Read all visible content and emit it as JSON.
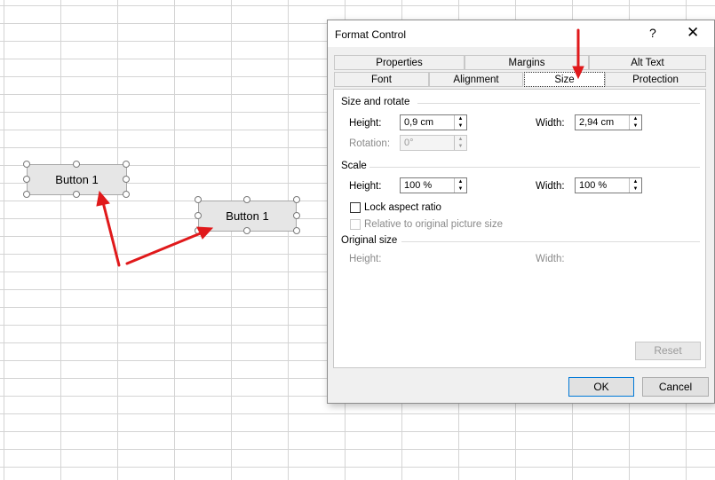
{
  "sheet": {
    "button1_label": "Button 1",
    "button2_label": "Button 1"
  },
  "dialog": {
    "title": "Format Control",
    "help_glyph": "?",
    "close_glyph": "✕",
    "tabs_top": [
      "Properties",
      "Margins",
      "Alt Text"
    ],
    "tabs_bottom": [
      "Font",
      "Alignment",
      "Size",
      "Protection"
    ],
    "active_tab": "Size",
    "size_rotate": {
      "heading": "Size and rotate",
      "height_label": "Height:",
      "height_value": "0,9 cm",
      "width_label": "Width:",
      "width_value": "2,94 cm",
      "rotation_label": "Rotation:",
      "rotation_value": "0°"
    },
    "scale": {
      "heading": "Scale",
      "height_label": "Height:",
      "height_value": "100 %",
      "width_label": "Width:",
      "width_value": "100 %",
      "lock_label": "Lock aspect ratio",
      "relative_label": "Relative to original picture size"
    },
    "original": {
      "heading": "Original size",
      "height_label": "Height:",
      "width_label": "Width:"
    },
    "reset_label": "Reset",
    "ok_label": "OK",
    "cancel_label": "Cancel"
  },
  "colors": {
    "annotation_arrow": "#e0191b",
    "focus_border": "#0078d7"
  }
}
